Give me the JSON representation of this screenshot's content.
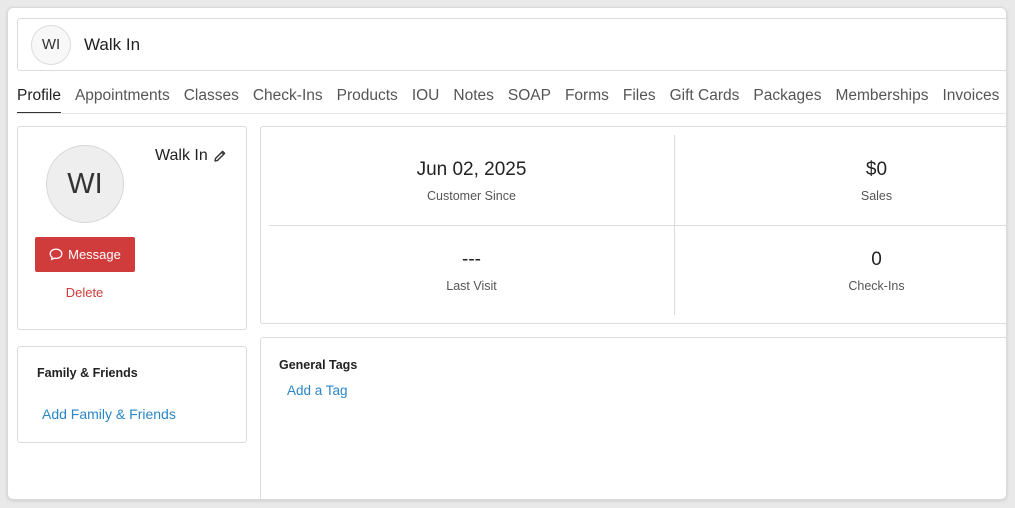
{
  "header": {
    "initials": "WI",
    "name": "Walk In"
  },
  "tabs": [
    {
      "label": "Profile",
      "active": true
    },
    {
      "label": "Appointments"
    },
    {
      "label": "Classes"
    },
    {
      "label": "Check-Ins"
    },
    {
      "label": "Products"
    },
    {
      "label": "IOU"
    },
    {
      "label": "Notes"
    },
    {
      "label": "SOAP"
    },
    {
      "label": "Forms"
    },
    {
      "label": "Files"
    },
    {
      "label": "Gift Cards"
    },
    {
      "label": "Packages"
    },
    {
      "label": "Memberships"
    },
    {
      "label": "Invoices"
    }
  ],
  "profile": {
    "initials": "WI",
    "name": "Walk In",
    "edit_icon": "pencil-icon",
    "message_label": "Message",
    "message_icon": "chat-bubble-icon",
    "delete_label": "Delete"
  },
  "family": {
    "title": "Family & Friends",
    "add_label": "Add Family & Friends"
  },
  "stats": [
    {
      "value": "Jun 02, 2025",
      "label": "Customer Since"
    },
    {
      "value": "$0",
      "label": "Sales"
    },
    {
      "value": "---",
      "label": "Last Visit"
    },
    {
      "value": "0",
      "label": "Check-Ins"
    }
  ],
  "tags": {
    "title": "General Tags",
    "add_label": "Add a Tag"
  },
  "colors": {
    "accent_red": "#d03b3b",
    "link_blue": "#2a86c8"
  }
}
